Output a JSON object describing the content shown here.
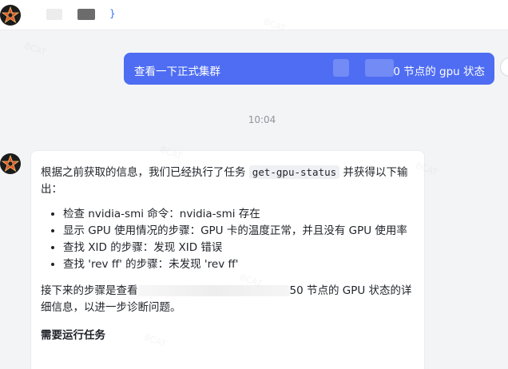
{
  "top_bar": {
    "link_text": "}"
  },
  "conversation": {
    "user_message": {
      "text_start": "查看一下正式集群",
      "text_end": "0 节点的 gpu 状态"
    },
    "timestamp": "10:04",
    "bot_message": {
      "intro_before_code": "根据之前获取的信息，我们已经执行了任务 ",
      "intro_code": "get-gpu-status",
      "intro_after_code": " 并获得以下输出：",
      "bullets": [
        "检查 nvidia-smi 命令：nvidia-smi 存在",
        "显示 GPU 使用情况的步骤：GPU 卡的温度正常，并且没有 GPU 使用率",
        "查找 XID 的步骤：发现 XID 错误",
        "查找 'rev ff' 的步骤：未发现 'rev ff'"
      ],
      "next_step_start": "接下来的步骤是查看",
      "next_step_end": "50 节点的 GPU 状态的详细信息，以进一步诊断问题。",
      "section_heading": "需要运行任务"
    }
  },
  "watermark": "BCAT"
}
